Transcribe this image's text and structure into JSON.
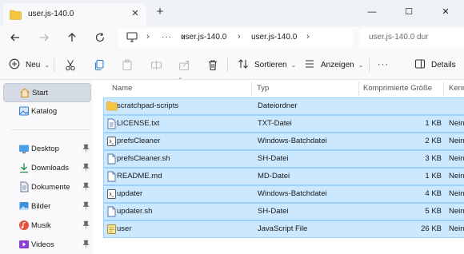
{
  "window": {
    "tab_title": "user.js-140.0",
    "new_tab_symbol": "+",
    "close_symbol": "✕",
    "minimize_symbol": "—",
    "maximize_symbol": "☐",
    "window_close_symbol": "✕"
  },
  "address_bar": {
    "more_label": "···",
    "path": [
      "user.js-140.0",
      "user.js-140.0"
    ],
    "search_placeholder": "user.js-140.0 dur"
  },
  "command_bar": {
    "new_label": "Neu",
    "sort_label": "Sortieren",
    "view_label": "Anzeigen",
    "more_label": "···",
    "details_label": "Details"
  },
  "sidebar": {
    "items": [
      {
        "label": "Start",
        "icon": "home-icon",
        "selected": true
      },
      {
        "label": "Katalog",
        "icon": "gallery-icon",
        "selected": false
      },
      {
        "label": "Desktop",
        "icon": "desktop-icon",
        "pinned": true
      },
      {
        "label": "Downloads",
        "icon": "download-icon",
        "pinned": true
      },
      {
        "label": "Dokumente",
        "icon": "document-icon",
        "pinned": true
      },
      {
        "label": "Bilder",
        "icon": "pictures-icon",
        "pinned": true
      },
      {
        "label": "Musik",
        "icon": "music-icon",
        "pinned": true
      },
      {
        "label": "Videos",
        "icon": "video-icon",
        "pinned": true
      }
    ],
    "pin_symbol": "📌"
  },
  "columns": {
    "name": "Name",
    "type": "Typ",
    "compressed_size": "Komprimierte Größe",
    "protected": "Kenn"
  },
  "files": [
    {
      "name": "scratchpad-scripts",
      "type": "Dateiordner",
      "size": "",
      "protected": "",
      "icon": "folder-icon"
    },
    {
      "name": "LICENSE.txt",
      "type": "TXT-Datei",
      "size": "1 KB",
      "protected": "Nein",
      "icon": "text-file-icon"
    },
    {
      "name": "prefsCleaner",
      "type": "Windows-Batchdatei",
      "size": "2 KB",
      "protected": "Nein",
      "icon": "batch-file-icon"
    },
    {
      "name": "prefsCleaner.sh",
      "type": "SH-Datei",
      "size": "3 KB",
      "protected": "Nein",
      "icon": "generic-file-icon"
    },
    {
      "name": "README.md",
      "type": "MD-Datei",
      "size": "1 KB",
      "protected": "Nein",
      "icon": "generic-file-icon"
    },
    {
      "name": "updater",
      "type": "Windows-Batchdatei",
      "size": "4 KB",
      "protected": "Nein",
      "icon": "batch-file-icon"
    },
    {
      "name": "updater.sh",
      "type": "SH-Datei",
      "size": "5 KB",
      "protected": "Nein",
      "icon": "generic-file-icon"
    },
    {
      "name": "user",
      "type": "JavaScript File",
      "size": "26 KB",
      "protected": "Nein",
      "icon": "javascript-file-icon"
    }
  ],
  "colors": {
    "selection_fill": "#cce8ff",
    "selection_border": "#99d1ff",
    "folder_yellow": "#f4c542",
    "accent_blue": "#0067c0"
  }
}
